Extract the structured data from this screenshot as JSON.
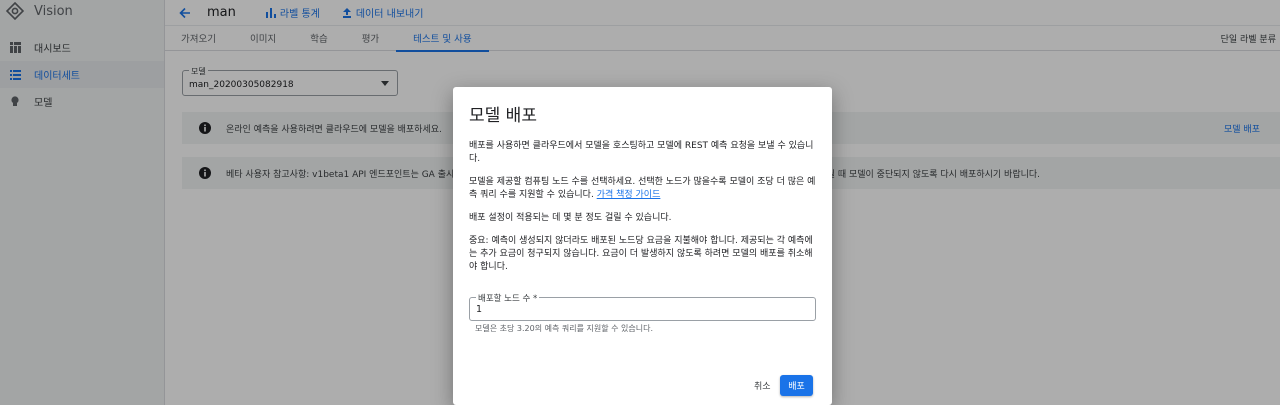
{
  "app": {
    "name": "Vision"
  },
  "sidebar": {
    "items": [
      {
        "label": "대시보드",
        "icon": "dashboard-icon"
      },
      {
        "label": "데이터세트",
        "icon": "list-icon",
        "active": true
      },
      {
        "label": "모델",
        "icon": "lightbulb-icon"
      }
    ]
  },
  "header": {
    "title": "man",
    "label_stats": "라벨 통계",
    "export_data": "데이터 내보내기"
  },
  "tabs": {
    "items": [
      "가져오기",
      "이미지",
      "학습",
      "평가",
      "테스트 및 사용"
    ],
    "active": "테스트 및 사용",
    "right_label": "단일 라벨 분류"
  },
  "model_select": {
    "label": "모델",
    "value": "man_20200305082918"
  },
  "banners": [
    {
      "text": "온라인 예측을 사용하려면 클라우드에 모델을 배포하세요.",
      "action": "모델 배포"
    },
    {
      "text": "베타 사용자 참고사항: v1beta1 API 엔드포인트는 GA 출시",
      "text_right": "가 종료될 때 모델이 중단되지 않도록 다시 배포하시기 바랍니다."
    }
  ],
  "dialog": {
    "title": "모델 배포",
    "p1": "배포를 사용하면 클라우드에서 모델을 호스팅하고 모델에 REST 예측 요청을 보낼 수 있습니다.",
    "p2_text": "모델을 제공할 컴퓨팅 노드 수를 선택하세요. 선택한 노드가 많을수록 모델이 조당 더 많은 예측 쿼리 수를 지원할 수 있습니다.",
    "p2_link": "가격 책정 가이드",
    "p3": "배포 설정이 적용되는 데 몇 분 정도 걸릴 수 있습니다.",
    "p4": "중요: 예측이 생성되지 않더라도 배포된 노드당 요금을 지불해야 합니다. 제공되는 각 예측에는 추가 요금이 청구되지 않습니다. 요금이 더 발생하지 않도록 하려면 모델의 배포를 취소해야 합니다.",
    "node_field": {
      "label": "배포할 노드 수 *",
      "value": "1"
    },
    "help": "모델은 초당 3.20의 예측 쿼리를 지원할 수 있습니다.",
    "cancel": "취소",
    "deploy": "배포"
  }
}
